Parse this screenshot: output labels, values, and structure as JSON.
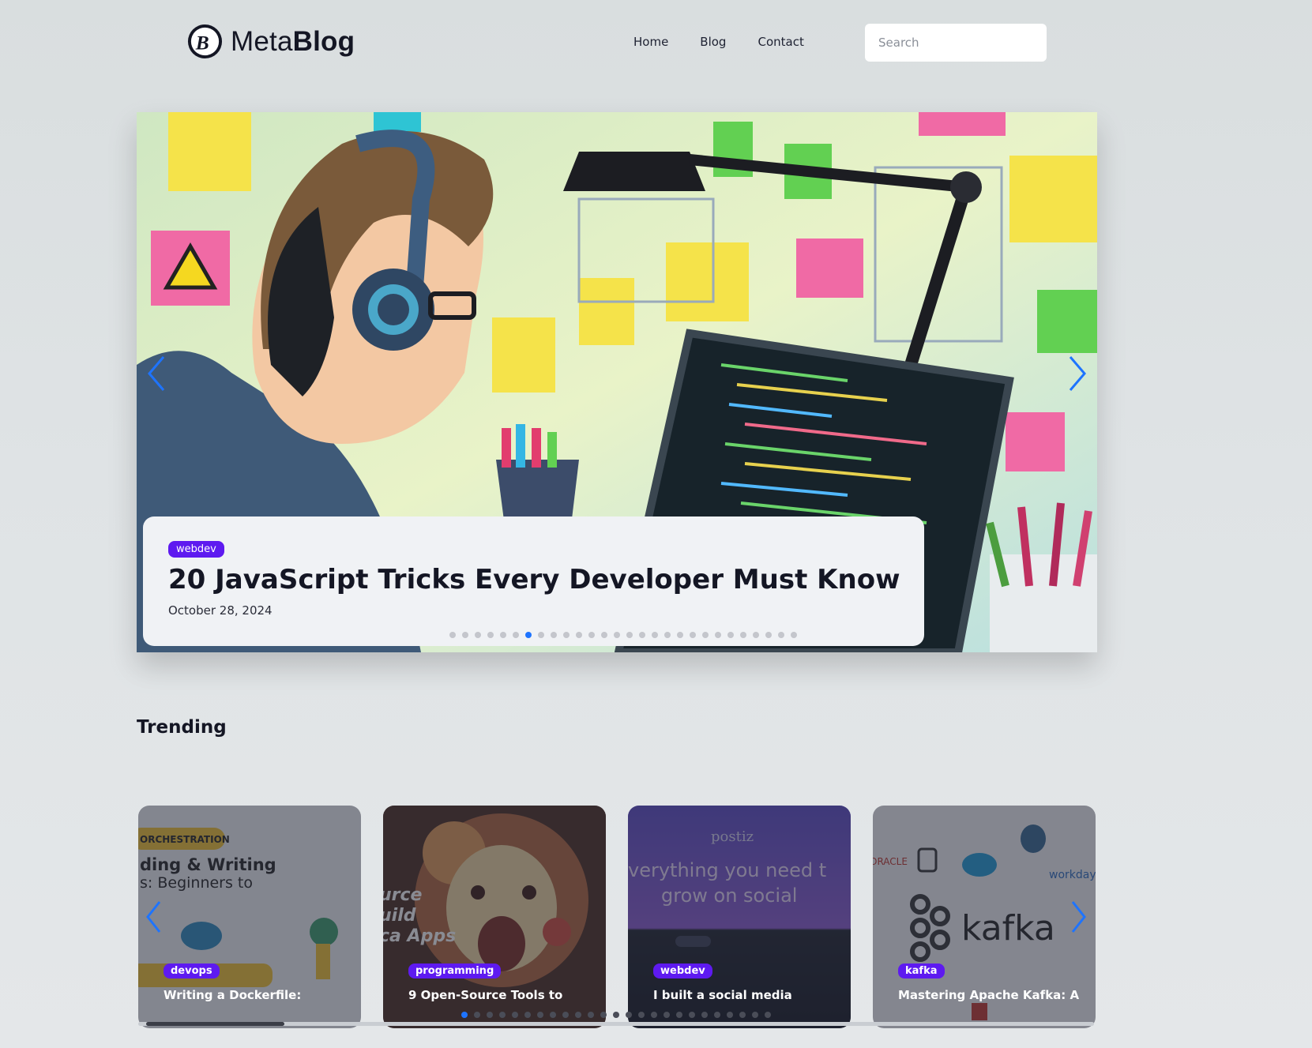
{
  "header": {
    "logo_light": "Meta",
    "logo_bold": "Blog",
    "nav": [
      {
        "label": "Home"
      },
      {
        "label": "Blog"
      },
      {
        "label": "Contact"
      }
    ],
    "search_placeholder": "Search"
  },
  "hero": {
    "tag": "webdev",
    "title": "20 JavaScript Tricks Every Developer Must Know",
    "date": "October 28, 2024",
    "slide_count": 28,
    "active_slide": 7
  },
  "trending": {
    "title": "Trending",
    "cards": [
      {
        "tag": "devops",
        "title": "Writing a Dockerfile:"
      },
      {
        "tag": "programming",
        "title": "9 Open-Source Tools to"
      },
      {
        "tag": "webdev",
        "title": "I built a social media"
      },
      {
        "tag": "kafka",
        "title": "Mastering Apache Kafka: A"
      }
    ],
    "dot_count": 25,
    "active_dot": 1
  },
  "colors": {
    "accent": "#5e1af0",
    "arrow": "#1e74ff",
    "background": "#dfe3e5"
  },
  "icons": [
    "metablog-logo-icon",
    "chevron-left-icon",
    "chevron-right-icon",
    "rocket-icon"
  ]
}
